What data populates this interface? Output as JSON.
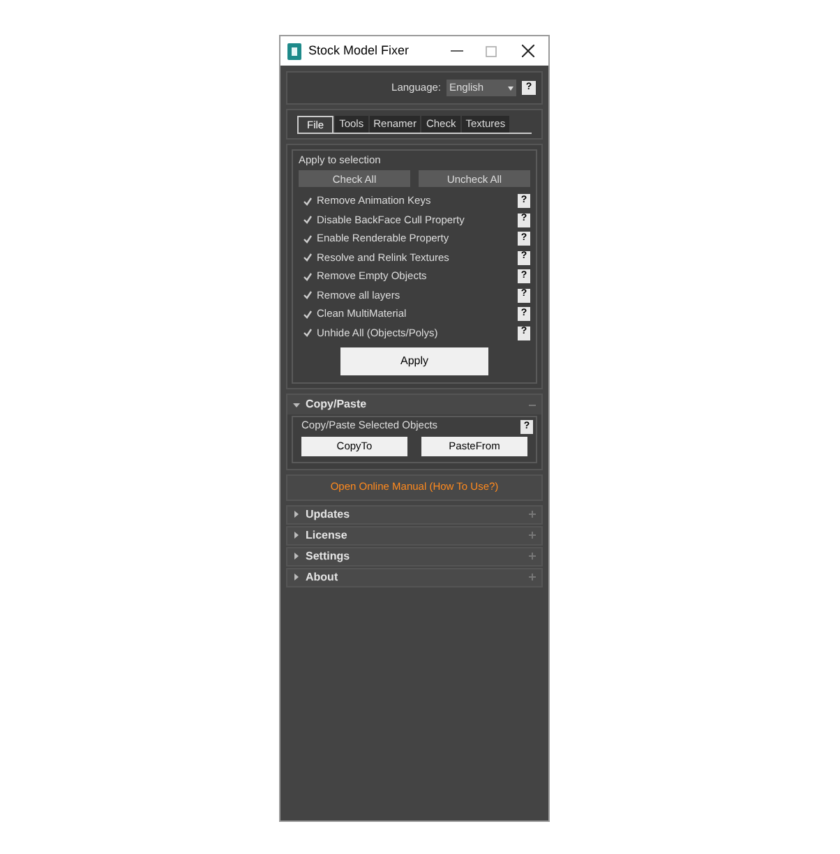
{
  "window": {
    "title": "Stock Model Fixer"
  },
  "language": {
    "label": "Language:",
    "value": "English",
    "help": "?"
  },
  "tabs": [
    {
      "label": "File",
      "selected": true
    },
    {
      "label": "Tools",
      "selected": false
    },
    {
      "label": "Renamer",
      "selected": false
    },
    {
      "label": "Check",
      "selected": false
    },
    {
      "label": "Textures",
      "selected": false
    }
  ],
  "apply_group": {
    "title": "Apply to selection",
    "buttons": [
      "Check All",
      "Uncheck All"
    ],
    "options": [
      {
        "label": "Remove Animation Keys",
        "checked": true,
        "help": "?"
      },
      {
        "label": "Disable BackFace Cull Property",
        "checked": true,
        "help": "?"
      },
      {
        "label": "Enable Renderable Property",
        "checked": true,
        "help": "?"
      },
      {
        "label": "Resolve and Relink Textures",
        "checked": true,
        "help": "?"
      },
      {
        "label": "Remove Empty Objects",
        "checked": true,
        "help": "?"
      },
      {
        "label": "Remove all layers",
        "checked": true,
        "help": "?"
      },
      {
        "label": "Clean MultiMaterial",
        "checked": true,
        "help": "?"
      },
      {
        "label": "Unhide All (Objects/Polys)",
        "checked": true,
        "help": "?"
      }
    ],
    "apply_button": "Apply"
  },
  "copy_paste": {
    "title": "Copy/Paste",
    "expanded": true,
    "group_title": "Copy/Paste Selected Objects",
    "help": "?",
    "buttons": [
      "CopyTo",
      "PasteFrom"
    ]
  },
  "manual_link": "Open Online Manual (How To Use?)",
  "rollouts": [
    {
      "title": "Updates",
      "expanded": false
    },
    {
      "title": "License",
      "expanded": false
    },
    {
      "title": "Settings",
      "expanded": false
    },
    {
      "title": "About",
      "expanded": false
    }
  ]
}
